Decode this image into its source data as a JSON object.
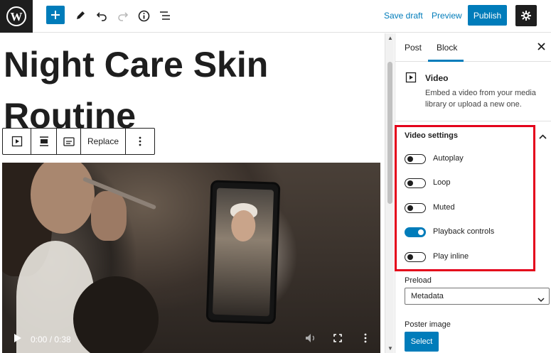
{
  "topbar": {
    "save_draft": "Save draft",
    "preview": "Preview",
    "publish": "Publish",
    "accent_color": "#007cba"
  },
  "editor": {
    "title_line1": "Night Care Skin",
    "title_line2": "Routine",
    "block_toolbar": {
      "replace": "Replace"
    },
    "video": {
      "time": "0:00 / 0:38"
    }
  },
  "sidebar": {
    "tabs": [
      {
        "label": "Post",
        "active": false
      },
      {
        "label": "Block",
        "active": true
      }
    ],
    "block": {
      "name": "Video",
      "description": "Embed a video from your media library or upload a new one."
    },
    "video_settings": {
      "title": "Video settings",
      "toggles": [
        {
          "label": "Autoplay",
          "on": false
        },
        {
          "label": "Loop",
          "on": false
        },
        {
          "label": "Muted",
          "on": false
        },
        {
          "label": "Playback controls",
          "on": true
        },
        {
          "label": "Play inline",
          "on": false
        }
      ]
    },
    "preload": {
      "label": "Preload",
      "value": "Metadata"
    },
    "poster": {
      "label": "Poster image",
      "button": "Select"
    }
  },
  "highlight_color": "#e4001b"
}
